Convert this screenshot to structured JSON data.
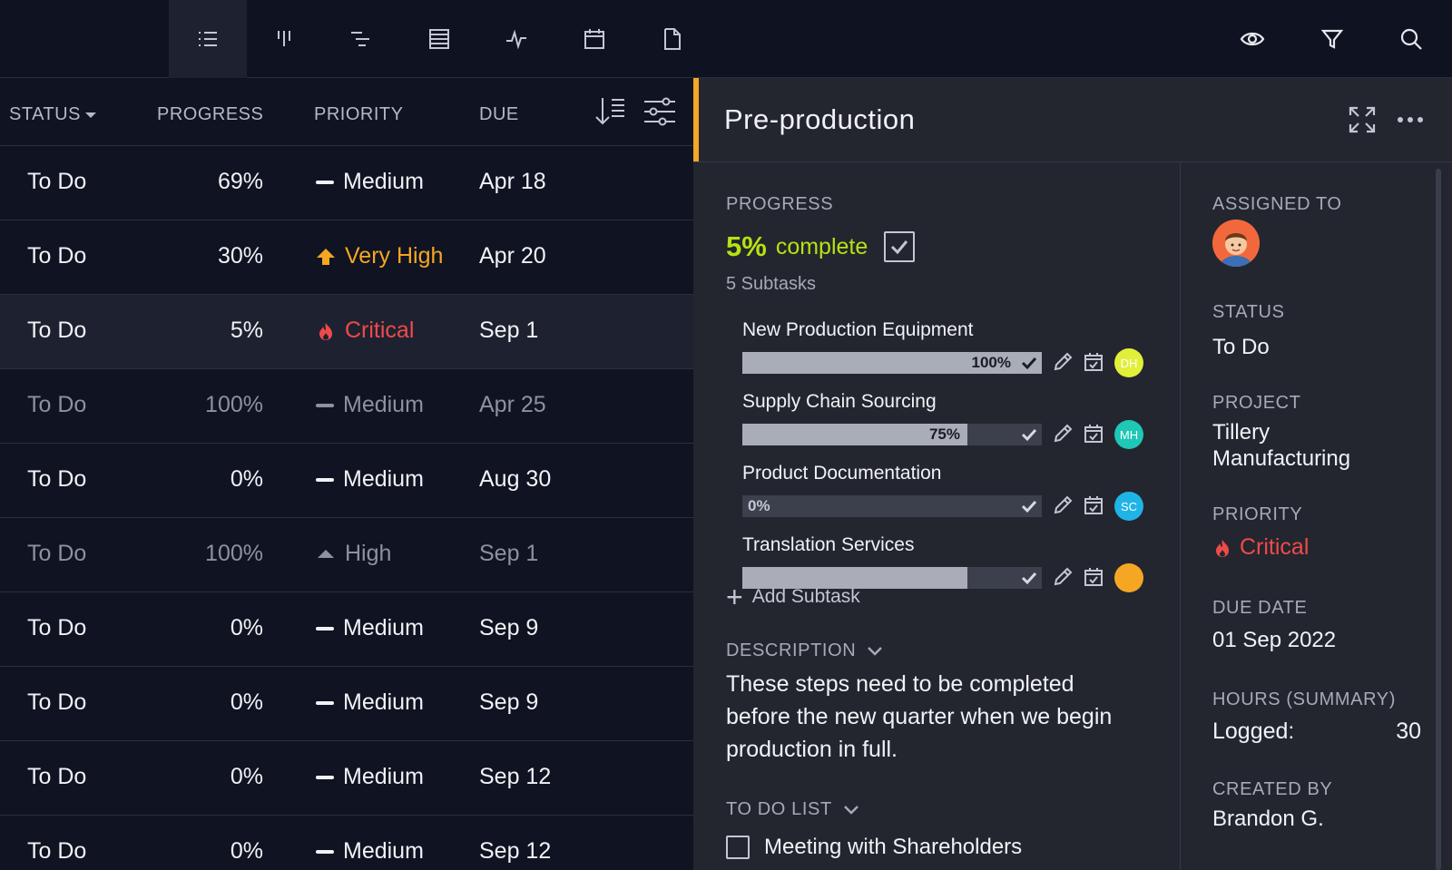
{
  "toolbar": {
    "views": [
      {
        "name": "list-view",
        "icon": "list-icon"
      },
      {
        "name": "board-view",
        "icon": "board-icon"
      },
      {
        "name": "gantt-view",
        "icon": "gantt-icon"
      },
      {
        "name": "sheet-view",
        "icon": "sheet-icon"
      },
      {
        "name": "dashboard-view",
        "icon": "dashboard-icon"
      },
      {
        "name": "calendar-view",
        "icon": "calendar-icon"
      },
      {
        "name": "files-view",
        "icon": "file-icon"
      }
    ],
    "active_view": "list-view",
    "tools": [
      "eye-icon",
      "filter-icon",
      "search-icon"
    ]
  },
  "table": {
    "headers": {
      "status": "STATUS",
      "progress": "PROGRESS",
      "priority": "PRIORITY",
      "due": "DUE"
    },
    "rows": [
      {
        "status": "To Do",
        "progress": "69%",
        "priority": "Medium",
        "priority_level": "medium",
        "due": "Apr 18",
        "dim": false,
        "selected": false
      },
      {
        "status": "To Do",
        "progress": "30%",
        "priority": "Very High",
        "priority_level": "very-high",
        "due": "Apr 20",
        "dim": false,
        "selected": false
      },
      {
        "status": "To Do",
        "progress": "5%",
        "priority": "Critical",
        "priority_level": "critical",
        "due": "Sep 1",
        "dim": false,
        "selected": true
      },
      {
        "status": "To Do",
        "progress": "100%",
        "priority": "Medium",
        "priority_level": "medium",
        "due": "Apr 25",
        "dim": true,
        "selected": false
      },
      {
        "status": "To Do",
        "progress": "0%",
        "priority": "Medium",
        "priority_level": "medium",
        "due": "Aug 30",
        "dim": false,
        "selected": false
      },
      {
        "status": "To Do",
        "progress": "100%",
        "priority": "High",
        "priority_level": "high",
        "due": "Sep 1",
        "dim": true,
        "selected": false
      },
      {
        "status": "To Do",
        "progress": "0%",
        "priority": "Medium",
        "priority_level": "medium",
        "due": "Sep 9",
        "dim": false,
        "selected": false
      },
      {
        "status": "To Do",
        "progress": "0%",
        "priority": "Medium",
        "priority_level": "medium",
        "due": "Sep 9",
        "dim": false,
        "selected": false
      },
      {
        "status": "To Do",
        "progress": "0%",
        "priority": "Medium",
        "priority_level": "medium",
        "due": "Sep 12",
        "dim": false,
        "selected": false
      },
      {
        "status": "To Do",
        "progress": "0%",
        "priority": "Medium",
        "priority_level": "medium",
        "due": "Sep 12",
        "dim": false,
        "selected": false
      }
    ]
  },
  "panel": {
    "title": "Pre-production",
    "accent_color": "#f5a623",
    "progress": {
      "label": "PROGRESS",
      "percent": "5%",
      "complete_text": "complete",
      "subtask_count": "5 Subtasks"
    },
    "subtasks": [
      {
        "name": "New Production Equipment",
        "percent_label": "100%",
        "fraction": 1.0,
        "initials": "DH",
        "avatar_color": "#e2ef3a",
        "done": true
      },
      {
        "name": "Supply Chain Sourcing",
        "percent_label": "75%",
        "fraction": 0.75,
        "initials": "MH",
        "avatar_color": "#1fc7b6",
        "done": false
      },
      {
        "name": "Product Documentation",
        "percent_label": "0%",
        "fraction": 0.0,
        "initials": "SC",
        "avatar_color": "#1fb4e6",
        "done": false
      },
      {
        "name": "Translation Services",
        "percent_label": "",
        "fraction": 0.75,
        "initials": "",
        "avatar_color": "#f5a623",
        "done": false
      }
    ],
    "add_subtask": "Add Subtask",
    "description": {
      "label": "DESCRIPTION",
      "text": "These steps need to be completed before the new quarter when we begin production in full."
    },
    "todo": {
      "label": "TO DO LIST",
      "items": [
        "Meeting with Shareholders"
      ]
    },
    "sidebar": {
      "assigned_label": "ASSIGNED TO",
      "status_label": "STATUS",
      "status_value": "To Do",
      "project_label": "PROJECT",
      "project_value": "Tillery Manufacturing",
      "priority_label": "PRIORITY",
      "priority_value": "Critical",
      "due_label": "DUE DATE",
      "due_value": "01 Sep 2022",
      "hours_label": "HOURS (SUMMARY)",
      "hours_logged_label": "Logged:",
      "hours_logged_value": "30",
      "created_label": "CREATED BY",
      "created_value": "Brandon G."
    }
  },
  "colors": {
    "critical": "#ef4a4a",
    "very_high": "#f5a623",
    "complete": "#b6e312"
  }
}
